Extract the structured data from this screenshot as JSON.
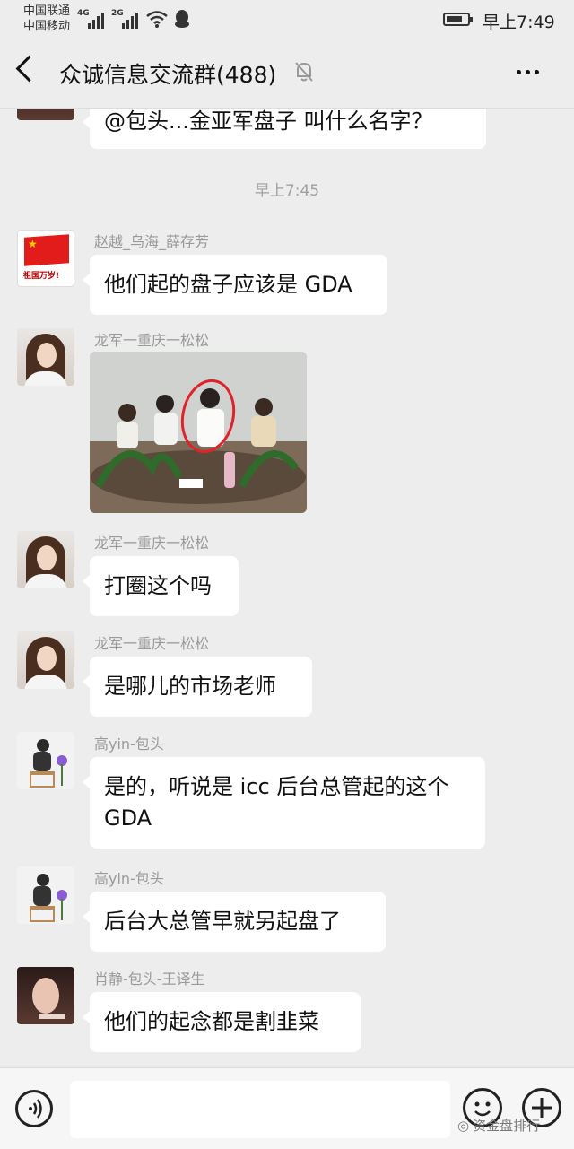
{
  "status_bar": {
    "carrier_1": "中国联通",
    "carrier_2": "中国移动",
    "network_1": "4G",
    "network_2": "2G",
    "time": "早上7:49",
    "battery_level": 0.75
  },
  "nav": {
    "title": "众诚信息交流群(488)",
    "icons": [
      "back-arrow-icon",
      "mute-bell-icon",
      "more-icon"
    ]
  },
  "chat": {
    "first_message": "@包头...金亚军盘子   叫什么名字？",
    "timestamp": "早上7:45",
    "messages": [
      {
        "sender": "赵越_乌海_薛存芳",
        "avatar": "china-flag-avatar",
        "avatar_text": "祖国万岁!",
        "text": "他们起的盘子应该是 GDA"
      },
      {
        "sender": "龙军一重庆一松松",
        "avatar": "girl-avatar",
        "type": "image",
        "image": "meeting-photo"
      },
      {
        "sender": "龙军一重庆一松松",
        "avatar": "girl-avatar",
        "text": "打圈这个吗"
      },
      {
        "sender": "龙军一重庆一松松",
        "avatar": "girl-avatar",
        "text": "是哪儿的市场老师"
      },
      {
        "sender": "高yin-包头",
        "avatar": "stool-avatar",
        "text": "是的，听说是 icc 后台总管起的这个 GDA"
      },
      {
        "sender": "高yin-包头",
        "avatar": "stool-avatar",
        "text": "后台大总管早就另起盘了"
      },
      {
        "sender": "肖静-包头-王译生",
        "avatar": "woman-avatar",
        "text": "他们的起念都是割韭菜"
      }
    ]
  },
  "input_bar": {
    "icons": [
      "voice-icon",
      "emoji-icon",
      "plus-icon"
    ],
    "placeholder": ""
  },
  "watermark": "资金盘排行"
}
